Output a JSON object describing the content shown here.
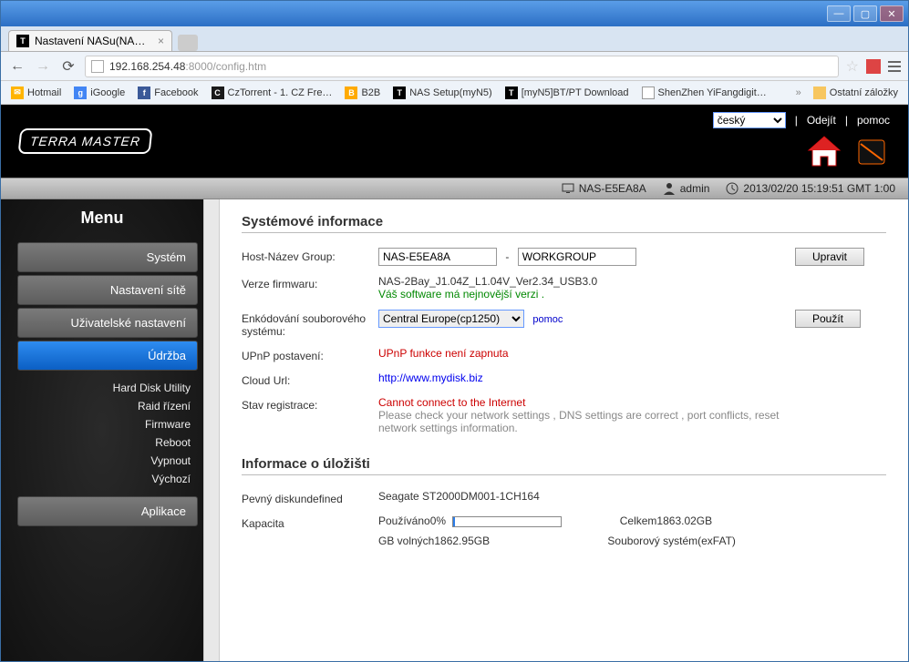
{
  "browser": {
    "tab_title": "Nastavení NASu(NAS-E5EA8…",
    "url_host": "192.168.254.48",
    "url_port": ":8000",
    "url_path": "/config.htm"
  },
  "bookmarks": {
    "hotmail": "Hotmail",
    "igoogle": "iGoogle",
    "facebook": "Facebook",
    "cztorrent": "CzTorrent - 1. CZ Fre…",
    "b2b": "B2B",
    "nassetup": "NAS Setup(myN5)",
    "myn5dl": "[myN5]BT/PT Download",
    "shenzhen": "ShenZhen YiFangdigit…",
    "other": "Ostatní záložky"
  },
  "header": {
    "logo": "TERRA MASTER",
    "lang": "český",
    "logout": "Odejít",
    "help": "pomoc"
  },
  "status": {
    "device": "NAS-E5EA8A",
    "user": "admin",
    "datetime": "2013/02/20 15:19:51 GMT 1:00"
  },
  "sidebar": {
    "title": "Menu",
    "items": [
      "Systém",
      "Nastavení sítě",
      "Uživatelské nastavení",
      "Údržba",
      "Aplikace"
    ],
    "sub_udrzba": [
      "Hard Disk Utility",
      "Raid řízení",
      "Firmware",
      "Reboot",
      "Vypnout",
      "Výchozí"
    ]
  },
  "sysinfo": {
    "heading": "Systémové informace",
    "host_label": "Host-Název Group:",
    "host_value": "NAS-E5EA8A",
    "group_value": "WORKGROUP",
    "edit_btn": "Upravit",
    "fw_label": "Verze firmwaru:",
    "fw_value": "NAS-2Bay_J1.04Z_L1.04V_Ver2.34_USB3.0",
    "fw_ok": "Váš software má nejnovější verzi .",
    "enc_label": "Enkódování souborového systému:",
    "enc_value": "Central Europe(cp1250)",
    "enc_help": "pomoc",
    "apply_btn": "Použít",
    "upnp_label": "UPnP postavení:",
    "upnp_value": "UPnP funkce není zapnuta",
    "cloud_label": "Cloud Url:",
    "cloud_value": "http://www.mydisk.biz",
    "reg_label": "Stav registrace:",
    "reg_err": "Cannot connect to the Internet",
    "reg_msg": "Please check your network settings , DNS settings are correct , port conflicts, reset network settings information."
  },
  "storage": {
    "heading": "Informace o úložišti",
    "disk_label": "Pevný diskundefined",
    "disk_value": "Seagate ST2000DM001-1CH164",
    "cap_label": "Kapacita",
    "used_label": "Používáno0%",
    "total": "Celkem1863.02GB",
    "free": "GB volných1862.95GB",
    "fs": "Souborový systém(exFAT)"
  }
}
